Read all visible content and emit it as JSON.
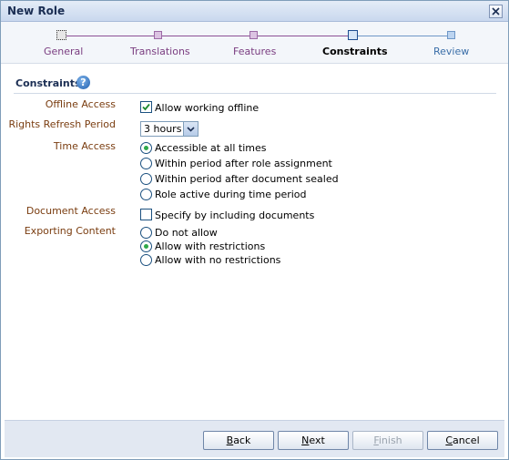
{
  "window": {
    "title": "New Role"
  },
  "train": {
    "steps": [
      {
        "label": "General",
        "state": "done"
      },
      {
        "label": "Translations",
        "state": "done"
      },
      {
        "label": "Features",
        "state": "done"
      },
      {
        "label": "Constraints",
        "state": "current"
      },
      {
        "label": "Review",
        "state": "future"
      }
    ]
  },
  "section": {
    "title": "Constraints",
    "help": "?"
  },
  "fields": {
    "offline_access": {
      "label": "Offline Access",
      "checkbox_label": "Allow working offline",
      "checked": true
    },
    "rights_refresh": {
      "label": "Rights Refresh Period",
      "selected": "3 hours"
    },
    "time_access": {
      "label": "Time Access",
      "options": [
        "Accessible at all times",
        "Within period after role assignment",
        "Within period after document sealed",
        "Role active during time period"
      ],
      "selected_index": 0
    },
    "document_access": {
      "label": "Document Access",
      "checkbox_label": "Specify by including documents",
      "checked": false
    },
    "exporting_content": {
      "label": "Exporting Content",
      "options": [
        "Do not allow",
        "Allow with restrictions",
        "Allow with no restrictions"
      ],
      "selected_index": 1
    }
  },
  "buttons": {
    "back": {
      "pre": "",
      "mnemonic": "B",
      "post": "ack"
    },
    "next": {
      "pre": "",
      "mnemonic": "N",
      "post": "ext"
    },
    "finish": {
      "pre": "",
      "mnemonic": "F",
      "post": "inish",
      "enabled": false
    },
    "cancel": {
      "pre": "",
      "mnemonic": "C",
      "post": "ancel"
    }
  },
  "colors": {
    "accent": "#1c2f54",
    "label": "#7a3d10",
    "radio_selected": "#2fa84a"
  }
}
